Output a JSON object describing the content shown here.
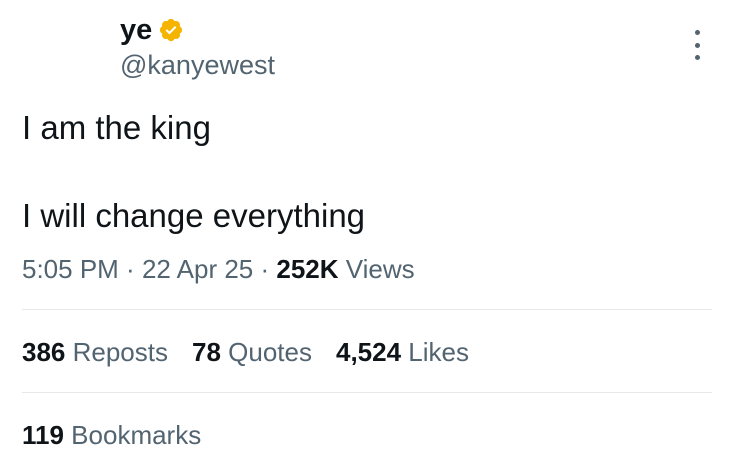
{
  "author": {
    "display_name": "ye",
    "handle": "@kanyewest",
    "verified_badge_color": "#f4b400"
  },
  "tweet": {
    "lines": [
      "I am the king",
      "I will change everything"
    ]
  },
  "meta": {
    "time": "5:05 PM",
    "separator": " · ",
    "date": "22 Apr 25",
    "views_count": "252K",
    "views_label": " Views"
  },
  "stats": {
    "reposts_count": "386",
    "reposts_label": " Reposts",
    "quotes_count": "78",
    "quotes_label": " Quotes",
    "likes_count": "4,524",
    "likes_label": " Likes",
    "bookmarks_count": "119",
    "bookmarks_label": " Bookmarks"
  },
  "icons": {
    "verified": "verified-badge-icon",
    "more": "more-options-icon"
  }
}
